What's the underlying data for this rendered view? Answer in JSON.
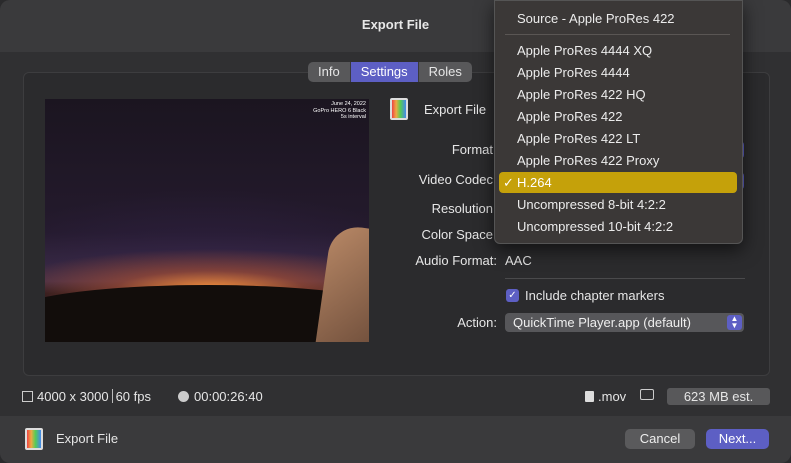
{
  "window": {
    "title": "Export File"
  },
  "tabs": [
    {
      "label": "Info",
      "active": false
    },
    {
      "label": "Settings",
      "active": true
    },
    {
      "label": "Roles",
      "active": false
    }
  ],
  "preview": {
    "stamp_lines": [
      "June 24, 2022",
      "GoPro HERO 6 Black",
      "5s interval"
    ]
  },
  "settings": {
    "file_type_label": "Export File",
    "rows": [
      {
        "label": "Format",
        "value": ""
      },
      {
        "label": "Video Codec",
        "value": ""
      },
      {
        "label": "Resolution",
        "value": ""
      },
      {
        "label": "Color Space",
        "value": ""
      },
      {
        "label": "Audio Format:",
        "value": "AAC"
      }
    ],
    "chapter_markers": {
      "label": "Include chapter markers",
      "checked": true
    },
    "action": {
      "label": "Action:",
      "value": "QuickTime Player.app (default)"
    }
  },
  "footer_info": {
    "dimensions": "4000 x 3000",
    "fps": "60 fps",
    "duration": "00:00:26:40",
    "extension": ".mov",
    "size_estimate": "623 MB est."
  },
  "footer": {
    "label": "Export File",
    "cancel": "Cancel",
    "next": "Next..."
  },
  "codec_menu": {
    "items": [
      "Source - Apple ProRes 422",
      "Apple ProRes 4444 XQ",
      "Apple ProRes 4444",
      "Apple ProRes 422 HQ",
      "Apple ProRes 422",
      "Apple ProRes 422 LT",
      "Apple ProRes 422 Proxy",
      "H.264",
      "Uncompressed 8-bit 4:2:2",
      "Uncompressed 10-bit 4:2:2"
    ],
    "selected": "H.264",
    "check_mark": "✓"
  },
  "colors": {
    "accent": "#5d5fc4",
    "menu_highlight": "#c5a10a"
  }
}
